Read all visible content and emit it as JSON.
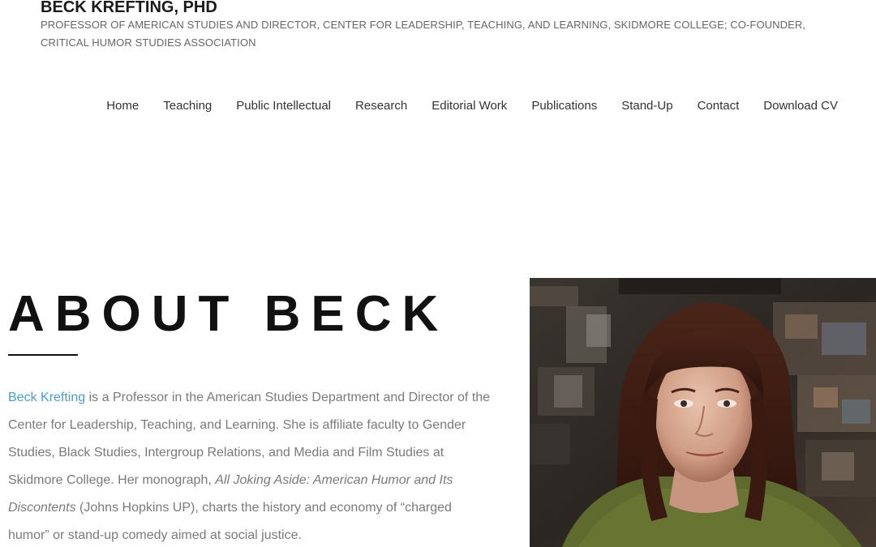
{
  "site": {
    "title": "BECK KREFTING, PHD",
    "tagline": "PROFESSOR OF AMERICAN STUDIES AND DIRECTOR, CENTER FOR LEADERSHIP, TEACHING, AND LEARNING, SKIDMORE COLLEGE; CO-FOUNDER, CRITICAL HUMOR STUDIES ASSOCIATION"
  },
  "nav": {
    "items": [
      {
        "label": "Home"
      },
      {
        "label": "Teaching"
      },
      {
        "label": "Public Intellectual"
      },
      {
        "label": "Research"
      },
      {
        "label": "Editorial Work"
      },
      {
        "label": "Publications"
      },
      {
        "label": "Stand-Up"
      },
      {
        "label": "Contact"
      },
      {
        "label": "Download CV"
      }
    ]
  },
  "about": {
    "heading": "ABOUT BECK",
    "bio": {
      "name_link": "Beck Krefting",
      "text1": " is a Professor in the American Studies Department and Director of the Center for Leadership, Teaching, and Learning. She is affiliate faculty to Gender Studies, Black Studies, Intergroup Relations, and Media and Film Studies at Skidmore College. Her monograph, ",
      "book_title": "All Joking Aside: American Humor and Its Discontents",
      "text2": " (Johns Hopkins UP), charts the history and economy of “charged humor” or stand-up comedy aimed at social justice."
    }
  },
  "colors": {
    "link": "#4a9ccc",
    "body_text": "#7a7a7a",
    "heading": "#111111"
  }
}
